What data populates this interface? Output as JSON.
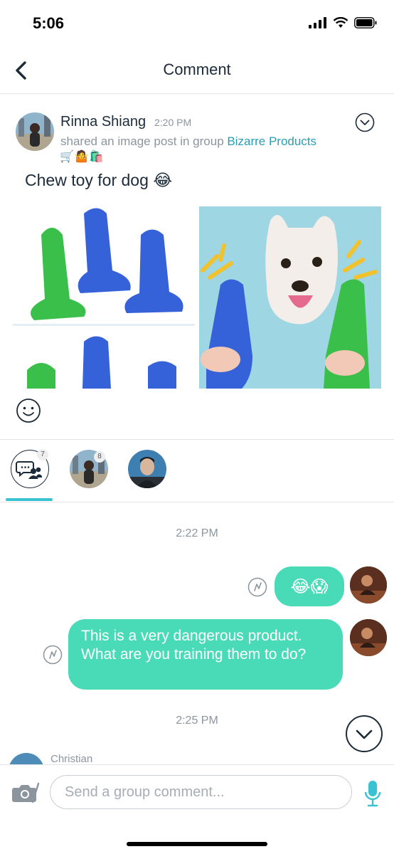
{
  "status_bar": {
    "time": "5:06"
  },
  "nav": {
    "title": "Comment"
  },
  "post": {
    "author": "Rinna Shiang",
    "time": "2:20 PM",
    "subtitle_prefix": "shared an image post in group ",
    "group_name": "Bizarre Products",
    "group_emojis": "🛒🤷🛍️",
    "text": "Chew toy for dog 😂"
  },
  "tabs": [
    {
      "name": "group-chat",
      "count": "7"
    },
    {
      "name": "rinna",
      "count": "8"
    },
    {
      "name": "christian",
      "count": ""
    }
  ],
  "messages": {
    "timestamp_1": "2:22 PM",
    "bubble_1": "😂😱",
    "bubble_2": "This is a very dangerous product. What are you training them to do?",
    "timestamp_2": "2:25 PM",
    "next_sender": "Christian"
  },
  "input": {
    "placeholder": "Send a group comment..."
  },
  "colors": {
    "accent": "#49dbb8",
    "link": "#2a9db3",
    "tab_indicator": "#38c2d2",
    "text": "#1c2b3a"
  }
}
